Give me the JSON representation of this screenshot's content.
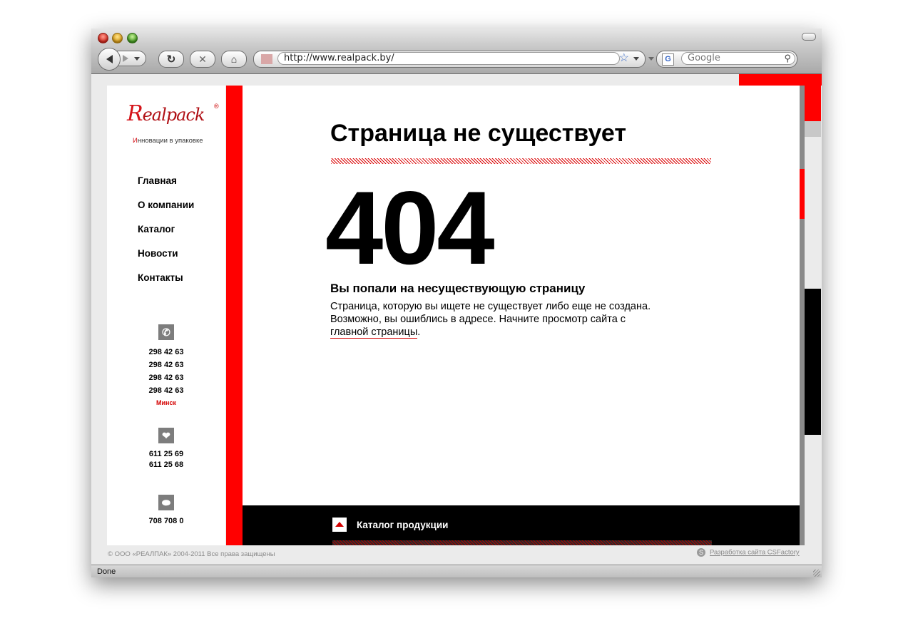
{
  "browser": {
    "url": "http://www.realpack.by/",
    "search_placeholder": "Google",
    "status": "Done"
  },
  "logo": {
    "word_initial": "R",
    "word_rest": "ealpack",
    "registered": "®",
    "tagline_first": "И",
    "tagline_rest": "нновации в упаковке"
  },
  "nav": {
    "items": [
      {
        "label": "Главная"
      },
      {
        "label": "О компании"
      },
      {
        "label": "Каталог"
      },
      {
        "label": "Новости"
      },
      {
        "label": "Контакты"
      }
    ]
  },
  "contacts": {
    "phones": [
      "298 42 63",
      "298 42 63",
      "298 42 63",
      "298 42 63"
    ],
    "city": "Минск",
    "velcom": [
      "611 25 69",
      "611 25 68"
    ],
    "life": [
      "708 708 0"
    ]
  },
  "content": {
    "title": "Страница не существует",
    "code": "404",
    "subtitle": "Вы попали на несуществующую страницу",
    "message": "Страница, которую вы ищете не существует либо еще не создана. Возможно, вы ошиблись в адресе. Начните просмотр сайта с",
    "link_label": "главной страницы",
    "after_link": "."
  },
  "catalog_bar": {
    "label": "Каталог продукции"
  },
  "footer": {
    "copyright": "© ООО «РЕАЛПАК»  2004-2011 Все права защищены",
    "developer": "Разработка сайта CSFactory"
  },
  "colors": {
    "accent": "#ff0000",
    "dark": "#000000",
    "panel": "#ebebeb"
  }
}
